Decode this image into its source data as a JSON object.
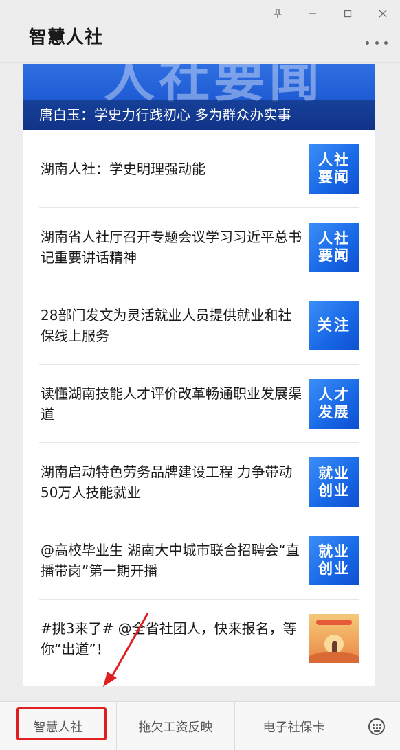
{
  "window": {
    "pin_icon": "pin-icon",
    "minimize_icon": "minimize-icon",
    "maximize_icon": "maximize-icon",
    "close_icon": "close-icon"
  },
  "header": {
    "title": "智慧人社",
    "more_icon": "more-icon"
  },
  "banner": {
    "big_text": "人社要闻",
    "caption": "唐白玉：学史力行践初心 多为群众办实事"
  },
  "news": [
    {
      "title": "湖南人社：学史明理强动能",
      "thumb_text": "人社要闻",
      "thumb_type": "tile"
    },
    {
      "title": "湖南省人社厅召开专题会议学习习近平总书记重要讲话精神",
      "thumb_text": "人社要闻",
      "thumb_type": "tile"
    },
    {
      "title": "28部门发文为灵活就业人员提供就业和社保线上服务",
      "thumb_text": "关注",
      "thumb_type": "tile-single"
    },
    {
      "title": "读懂湖南技能人才评价改革畅通职业发展渠道",
      "thumb_text": "人才发展",
      "thumb_type": "tile"
    },
    {
      "title": "湖南启动特色劳务品牌建设工程  力争带动50万人技能就业",
      "thumb_text": "就业创业",
      "thumb_type": "tile"
    },
    {
      "title": "@高校毕业生 湖南大中城市联合招聘会“直播带岗”第一期开播",
      "thumb_text": "就业创业",
      "thumb_type": "tile"
    },
    {
      "title": "#挑3来了# @全省社团人，快来报名，等你“出道”！",
      "thumb_text": "",
      "thumb_type": "poster"
    }
  ],
  "tabbar": {
    "tabs": [
      {
        "label": "智慧人社"
      },
      {
        "label": "拖欠工资反映"
      },
      {
        "label": "电子社保卡"
      }
    ],
    "keyboard_icon": "keyboard-icon"
  },
  "annotation": {
    "highlight_color": "#e02020"
  }
}
